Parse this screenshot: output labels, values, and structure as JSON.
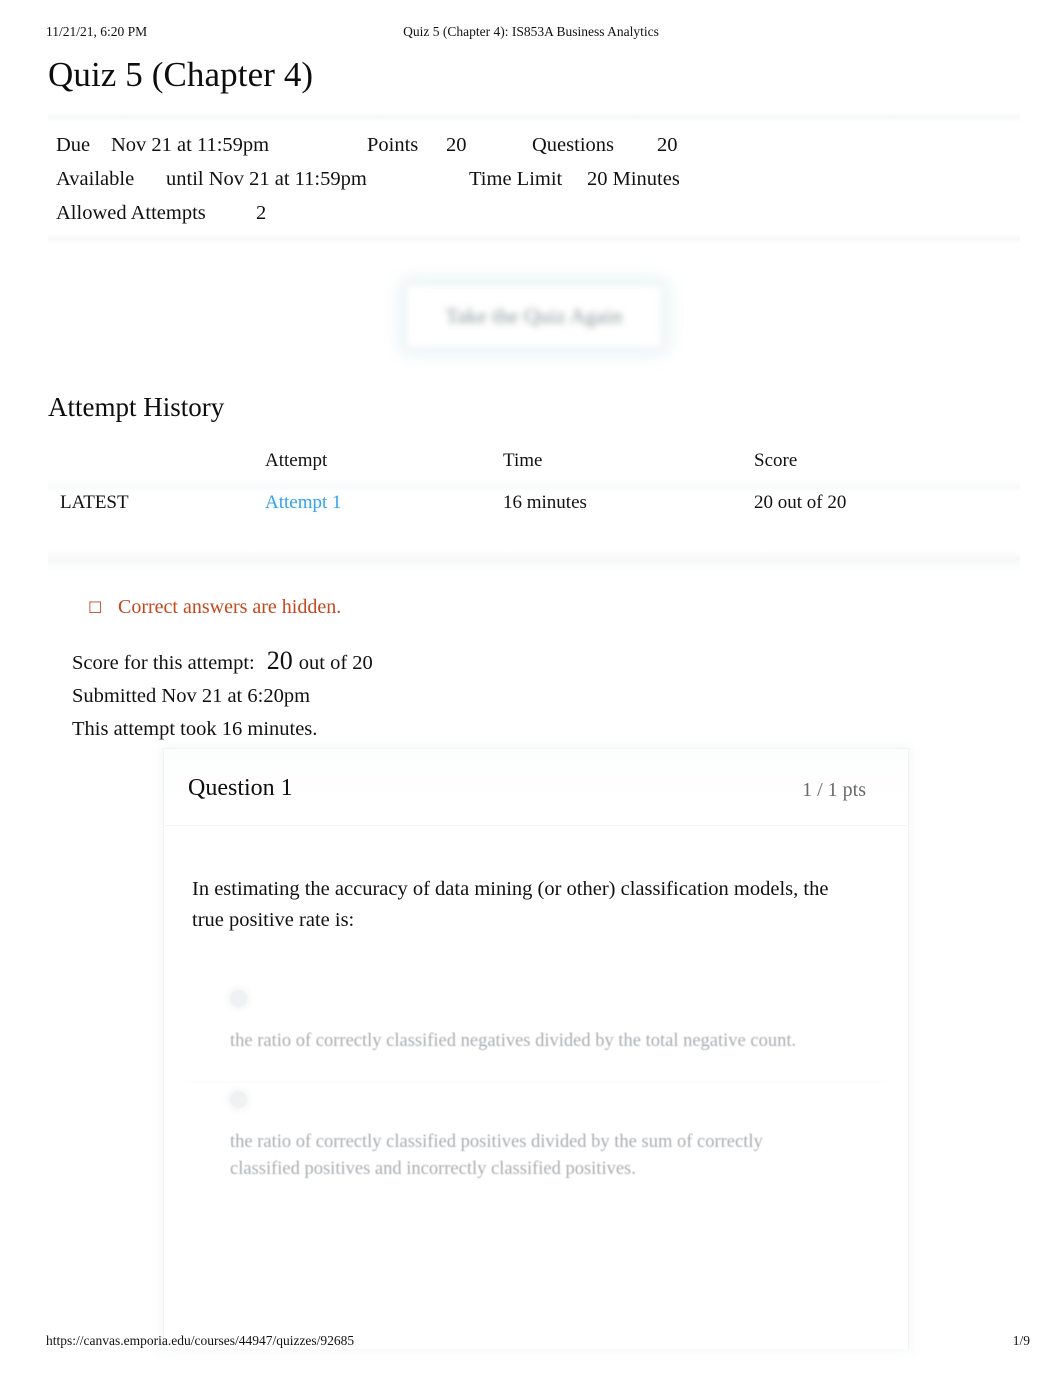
{
  "print": {
    "date": "11/21/21, 6:20 PM",
    "doc_title": "Quiz 5 (Chapter 4): IS853A Business Analytics",
    "footer_url": "https://canvas.emporia.edu/courses/44947/quizzes/92685",
    "page_number": "1/9"
  },
  "quiz": {
    "title": "Quiz 5 (Chapter 4)",
    "meta": {
      "due_label": "Due",
      "due_value": "Nov 21 at 11:59pm",
      "points_label": "Points",
      "points_value": "20",
      "questions_label": "Questions",
      "questions_value": "20",
      "available_label": "Available",
      "available_value": "until Nov 21 at 11:59pm",
      "time_limit_label": "Time Limit",
      "time_limit_value": "20 Minutes",
      "allowed_attempts_label": "Allowed Attempts",
      "allowed_attempts_value": "2"
    },
    "retake_button_label": "Take the Quiz Again"
  },
  "attempt_history": {
    "heading": "Attempt History",
    "columns": [
      "",
      "Attempt",
      "Time",
      "Score"
    ],
    "rows": [
      {
        "flag": "LATEST",
        "attempt": "Attempt 1",
        "time": "16 minutes",
        "score": "20 out of 20"
      }
    ]
  },
  "notice": {
    "icon": "info-circle-icon",
    "glyph": "☐",
    "text": "Correct answers are hidden.",
    "color": "#c4481d"
  },
  "attempt_summary": {
    "score_label": "Score for this attempt:",
    "score_value": "20",
    "score_suffix": "out of 20",
    "submitted": "Submitted Nov 21 at 6:20pm",
    "duration": "This attempt took 16 minutes."
  },
  "question": {
    "name": "Question 1",
    "points": "1 / 1 pts",
    "text": "In estimating the accuracy of data mining (or other) classification models, the true positive rate is:",
    "answers": [
      {
        "text": "the ratio of correctly classified negatives divided by the total negative count."
      },
      {
        "text": "the ratio of correctly classified positives divided by the sum of correctly classified positives and incorrectly classified positives."
      }
    ]
  },
  "colors": {
    "link": "#3ea2e0",
    "warning": "#c4481d",
    "text": "#111111",
    "muted": "#a9adb1"
  }
}
